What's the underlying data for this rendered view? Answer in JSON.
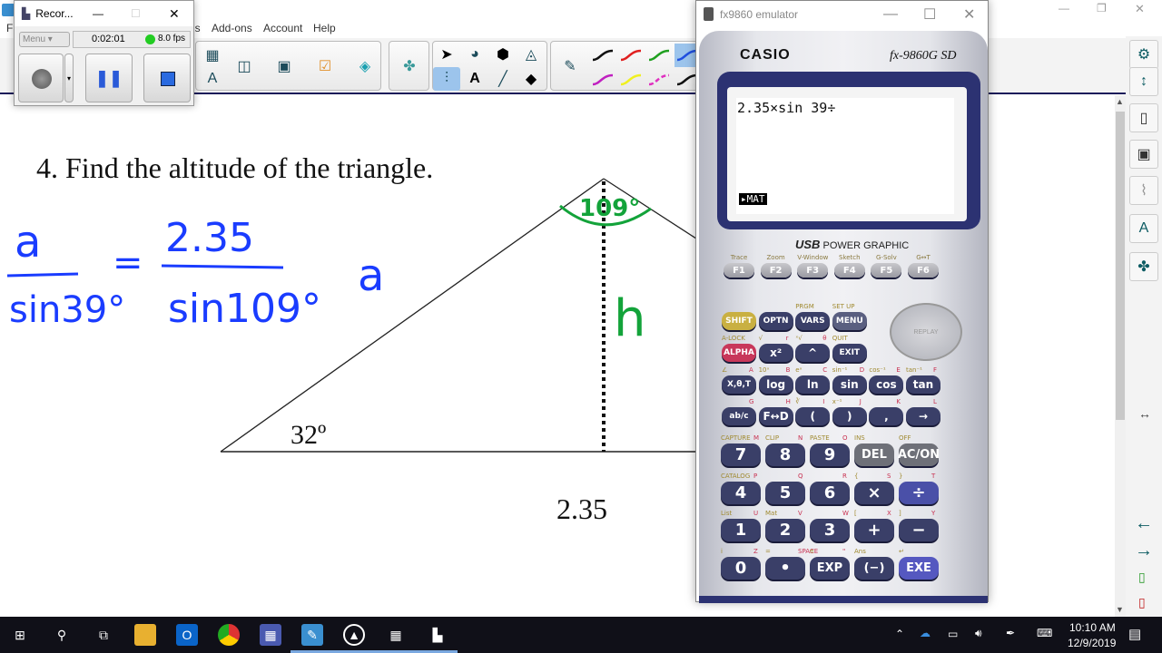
{
  "notebook": {
    "menu": [
      "Fi",
      "ls",
      "Add-ons",
      "Account",
      "Help"
    ],
    "window_controls": {
      "minimize": "—",
      "restore": "❐",
      "close": "✕"
    },
    "question": "4. Find the altitude of the triangle.",
    "angle_label": "32º",
    "base_label": "2.35",
    "handwriting": {
      "numerator_left": "a",
      "denominator_left": "sin39°",
      "equals": "=",
      "numerator_right": "2.35",
      "denominator_right": "sin109°",
      "trailing": "a",
      "apex_angle": "109°",
      "altitude": "h"
    },
    "colors": {
      "ink_blue": "#1a3cff",
      "ink_green": "#13a33a",
      "selected_tool": "#9cc4ec"
    },
    "pen_colors": [
      "#111111",
      "#e02020",
      "#20a020",
      "#2050e0",
      "#c020c0",
      "#f0f020",
      "#e030c0",
      "#111111"
    ]
  },
  "recorder": {
    "title": "Recor...",
    "menu_label": "Menu",
    "elapsed": "0:02:01",
    "fps": "8.0 fps",
    "status_color": "#22cc22"
  },
  "calculator": {
    "window_title": "fx9860 emulator",
    "brand": "CASIO",
    "model": "fx-9860G SD",
    "usb_label": "USB",
    "power_label": "POWER GRAPHIC",
    "display_line": "2.35×sin 39÷",
    "soft_key": "▸MAT",
    "replay_label": "REPLAY",
    "fkeys": [
      {
        "label": "F1",
        "top": "Trace"
      },
      {
        "label": "F2",
        "top": "Zoom"
      },
      {
        "label": "F3",
        "top": "V-Window"
      },
      {
        "label": "F4",
        "top": "Sketch"
      },
      {
        "label": "F5",
        "top": "G-Solv"
      },
      {
        "label": "F6",
        "top": "G↔T"
      }
    ],
    "upper_rows": [
      [
        {
          "label": "SHIFT",
          "top": "",
          "alpha": "",
          "color": "#c9b042"
        },
        {
          "label": "OPTN",
          "top": "",
          "alpha": ""
        },
        {
          "label": "VARS",
          "top": "PRGM",
          "alpha": ""
        },
        {
          "label": "MENU",
          "top": "SET UP",
          "alpha": "",
          "color": "#5a5f80"
        }
      ],
      [
        {
          "label": "ALPHA",
          "top": "A-LOCK",
          "alpha": "",
          "color": "#c8385a"
        },
        {
          "label": "x²",
          "top": "√",
          "alpha": "r"
        },
        {
          "label": "^",
          "top": "ˣ√",
          "alpha": "θ"
        },
        {
          "label": "EXIT",
          "top": "QUIT",
          "alpha": ""
        }
      ],
      [
        {
          "label": "X,θ,T",
          "top": "∠",
          "alpha": "A"
        },
        {
          "label": "log",
          "top": "10ˣ",
          "alpha": "B"
        },
        {
          "label": "ln",
          "top": "eˣ",
          "alpha": "C"
        },
        {
          "label": "sin",
          "top": "sin⁻¹",
          "alpha": "D"
        },
        {
          "label": "cos",
          "top": "cos⁻¹",
          "alpha": "E"
        },
        {
          "label": "tan",
          "top": "tan⁻¹",
          "alpha": "F"
        }
      ],
      [
        {
          "label": "ab/c",
          "top": "",
          "alpha": "G"
        },
        {
          "label": "F↔D",
          "top": "",
          "alpha": "H"
        },
        {
          "label": "(",
          "top": "∛",
          "alpha": "I"
        },
        {
          "label": ")",
          "top": "x⁻¹",
          "alpha": "J"
        },
        {
          "label": ",",
          "top": "",
          "alpha": "K"
        },
        {
          "label": "→",
          "top": "",
          "alpha": "L"
        }
      ]
    ],
    "number_rows": [
      [
        {
          "label": "7",
          "top": "CAPTURE",
          "alpha": "M"
        },
        {
          "label": "8",
          "top": "CLIP",
          "alpha": "N"
        },
        {
          "label": "9",
          "top": "PASTE",
          "alpha": "O"
        },
        {
          "label": "DEL",
          "top": "INS",
          "alpha": "",
          "color": "#6e7078"
        },
        {
          "label": "AC/ON",
          "top": "OFF",
          "alpha": "",
          "color": "#6e7078"
        }
      ],
      [
        {
          "label": "4",
          "top": "CATALOG",
          "alpha": "P"
        },
        {
          "label": "5",
          "top": "",
          "alpha": "Q"
        },
        {
          "label": "6",
          "top": "",
          "alpha": "R"
        },
        {
          "label": "×",
          "top": "{",
          "alpha": "S"
        },
        {
          "label": "÷",
          "top": "}",
          "alpha": "T",
          "color": "#4a50a8"
        }
      ],
      [
        {
          "label": "1",
          "top": "List",
          "alpha": "U"
        },
        {
          "label": "2",
          "top": "Mat",
          "alpha": "V"
        },
        {
          "label": "3",
          "top": "",
          "alpha": "W"
        },
        {
          "label": "+",
          "top": "[",
          "alpha": "X"
        },
        {
          "label": "−",
          "top": "]",
          "alpha": "Y"
        }
      ],
      [
        {
          "label": "0",
          "top": "i",
          "alpha": "Z"
        },
        {
          "label": "•",
          "top": "=",
          "alpha": "SPACE"
        },
        {
          "label": "EXP",
          "top": "π",
          "alpha": "\""
        },
        {
          "label": "(−)",
          "top": "Ans",
          "alpha": ""
        },
        {
          "label": "EXE",
          "top": "↵",
          "alpha": "",
          "color": "#5558c0"
        }
      ]
    ]
  },
  "taskbar": {
    "time": "10:10 AM",
    "date": "12/9/2019"
  }
}
